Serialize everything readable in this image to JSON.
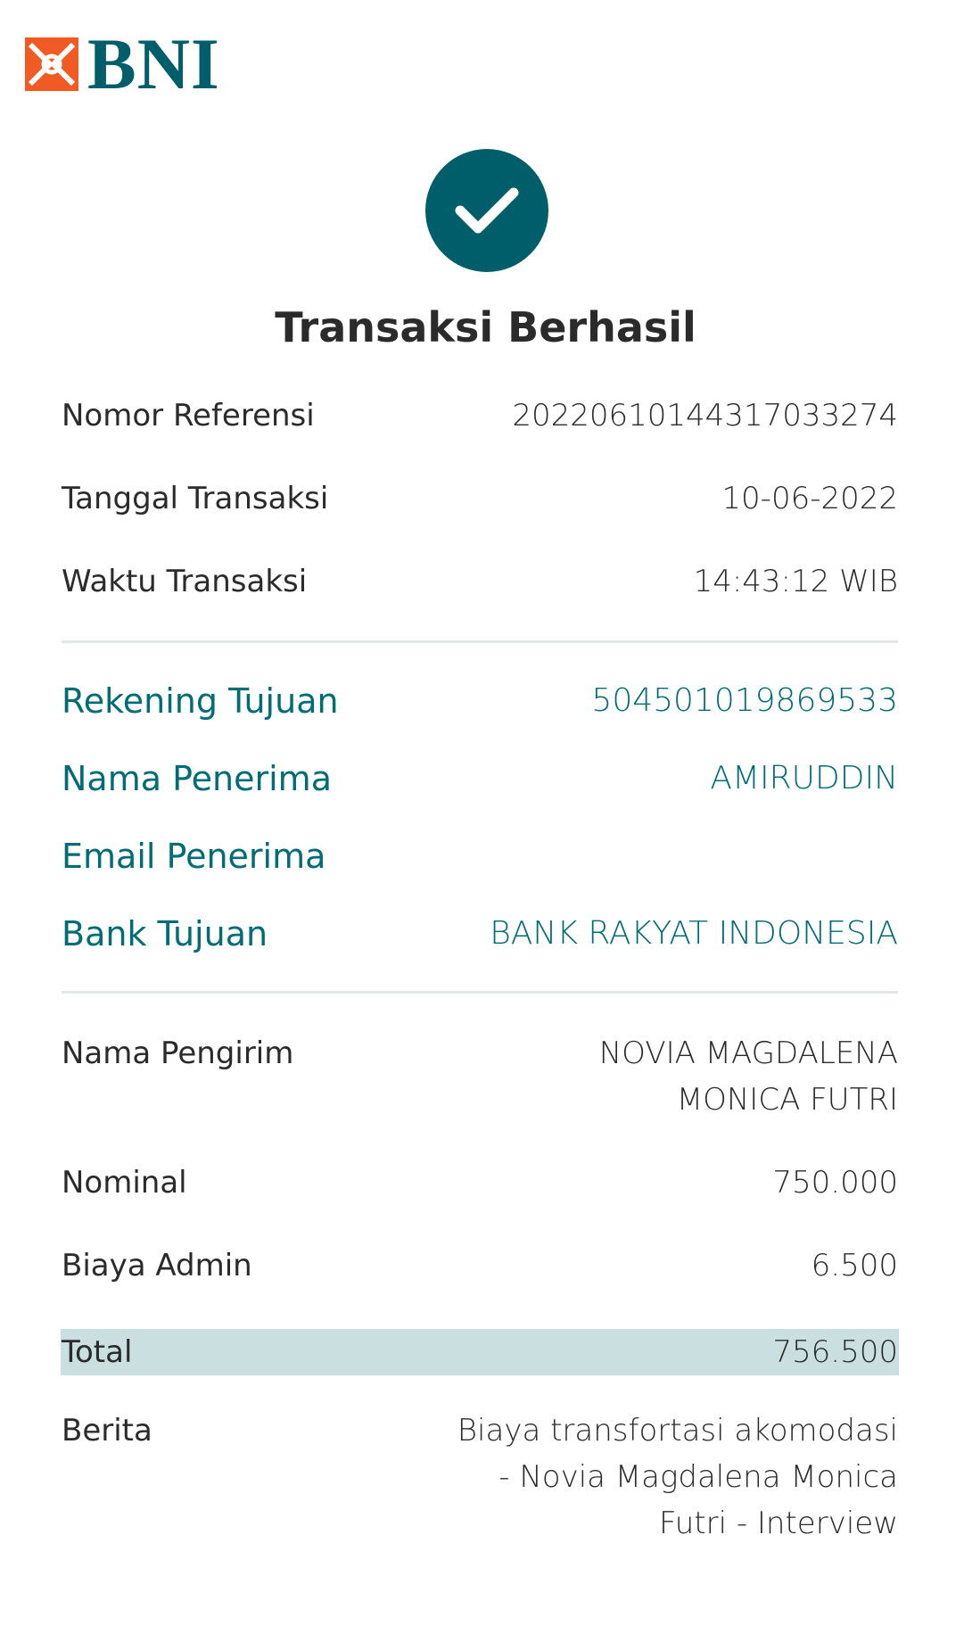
{
  "brand": {
    "logo_text": "BNI",
    "primary_color": "#005e6a",
    "accent_color": "#f15a22"
  },
  "status": {
    "icon": "checkmark-icon",
    "title": "Transaksi Berhasil"
  },
  "transaction": {
    "reference_label": "Nomor Referensi",
    "reference_value": "20220610144317033274",
    "date_label": "Tanggal Transaksi",
    "date_value": "10-06-2022",
    "time_label": "Waktu Transaksi",
    "time_value": "14:43:12 WIB"
  },
  "recipient": {
    "account_label": "Rekening Tujuan",
    "account_value": "504501019869533",
    "name_label": "Nama Penerima",
    "name_value": "AMIRUDDIN",
    "email_label": "Email Penerima",
    "email_value": "",
    "bank_label": "Bank Tujuan",
    "bank_value": "BANK RAKYAT INDONESIA"
  },
  "payment": {
    "sender_label": "Nama Pengirim",
    "sender_value_line1": "NOVIA MAGDALENA",
    "sender_value_line2": "MONICA FUTRI",
    "amount_label": "Nominal",
    "amount_value": "750.000",
    "fee_label": "Biaya Admin",
    "fee_value": "6.500",
    "total_label": "Total",
    "total_value": "756.500",
    "note_label": "Berita",
    "note_line1": "Biaya transfortasi akomodasi",
    "note_line2": "- Novia Magdalena Monica",
    "note_line3": "Futri - Interview"
  }
}
